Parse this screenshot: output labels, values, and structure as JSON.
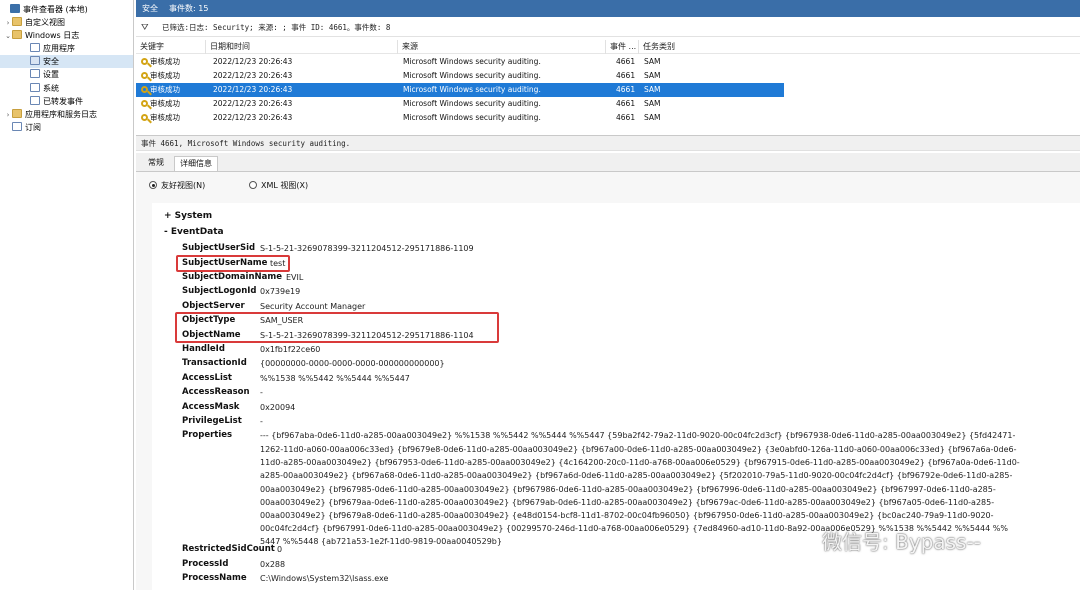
{
  "header": {
    "title": "安全",
    "event_count": "事件数: 15"
  },
  "tree": [
    {
      "label": "事件查看器 (本地)",
      "icon": "viewer-icon",
      "toggle": ""
    },
    {
      "label": "自定义视图",
      "icon": "folder-icon",
      "toggle": ">"
    },
    {
      "label": "Windows 日志",
      "icon": "folder-icon",
      "toggle": "v"
    },
    {
      "label": "应用程序",
      "icon": "log-icon",
      "toggle": ""
    },
    {
      "label": "安全",
      "icon": "log-icon",
      "toggle": "",
      "selected": true
    },
    {
      "label": "设置",
      "icon": "log-icon",
      "toggle": ""
    },
    {
      "label": "系统",
      "icon": "log-icon",
      "toggle": ""
    },
    {
      "label": "已转发事件",
      "icon": "log-icon",
      "toggle": ""
    },
    {
      "label": "应用程序和服务日志",
      "icon": "folder-icon",
      "toggle": ">"
    },
    {
      "label": "订阅",
      "icon": "log-icon",
      "toggle": ""
    }
  ],
  "filter": {
    "text": "已筛选:日志: Security; 来源: ; 事件 ID: 4661。事件数: 8",
    "icon": "filter-icon"
  },
  "columns": {
    "keywords": "关键字",
    "datetime": "日期和时间",
    "source": "来源",
    "event_id": "事件 ...",
    "category": "任务类别"
  },
  "events": [
    {
      "keyword": "审核成功",
      "datetime": "2022/12/23 20:26:43",
      "source": "Microsoft Windows security auditing.",
      "event_id": "4661",
      "category": "SAM"
    },
    {
      "keyword": "审核成功",
      "datetime": "2022/12/23 20:26:43",
      "source": "Microsoft Windows security auditing.",
      "event_id": "4661",
      "category": "SAM"
    },
    {
      "keyword": "审核成功",
      "datetime": "2022/12/23 20:26:43",
      "source": "Microsoft Windows security auditing.",
      "event_id": "4661",
      "category": "SAM",
      "selected": true
    },
    {
      "keyword": "审核成功",
      "datetime": "2022/12/23 20:26:43",
      "source": "Microsoft Windows security auditing.",
      "event_id": "4661",
      "category": "SAM"
    },
    {
      "keyword": "审核成功",
      "datetime": "2022/12/23 20:26:43",
      "source": "Microsoft Windows security auditing.",
      "event_id": "4661",
      "category": "SAM"
    }
  ],
  "detail": {
    "title": "事件 4661, Microsoft Windows security auditing.",
    "tabs": {
      "general": "常规",
      "details": "详细信息"
    },
    "view_friendly": "友好视图(N)",
    "view_xml": "XML 视图(X)",
    "system_label": "+ System",
    "eventdata_label": "- EventData",
    "fields": [
      {
        "key": "SubjectUserSid",
        "value": "S-1-5-21-3269078399-3211204512-295171886-1109"
      },
      {
        "key": "SubjectUserName",
        "value": "test"
      },
      {
        "key": "SubjectDomainName",
        "value": "EVIL"
      },
      {
        "key": "SubjectLogonId",
        "value": "0x739e19"
      },
      {
        "key": "ObjectServer",
        "value": "Security Account Manager"
      },
      {
        "key": "ObjectType",
        "value": "SAM_USER"
      },
      {
        "key": "ObjectName",
        "value": "S-1-5-21-3269078399-3211204512-295171886-1104"
      },
      {
        "key": "HandleId",
        "value": "0x1fb1f22ce60"
      },
      {
        "key": "TransactionId",
        "value": "{00000000-0000-0000-0000-000000000000}"
      },
      {
        "key": "AccessList",
        "value": "%%1538 %%5442 %%5444 %%5447"
      },
      {
        "key": "AccessReason",
        "value": "-"
      },
      {
        "key": "AccessMask",
        "value": "0x20094"
      },
      {
        "key": "PrivilegeList",
        "value": "-"
      },
      {
        "key": "Properties",
        "value": "--- {bf967aba-0de6-11d0-a285-00aa003049e2} %%1538 %%5442 %%5444 %%5447 {59ba2f42-79a2-11d0-9020-00c04fc2d3cf} {bf967938-0de6-11d0-a285-00aa003049e2} {5fd42471-"
      }
    ],
    "properties_lines": [
      "1262-11d0-a060-00aa006c33ed} {bf9679e8-0de6-11d0-a285-00aa003049e2} {bf967a00-0de6-11d0-a285-00aa003049e2} {3e0abfd0-126a-11d0-a060-00aa006c33ed} {bf967a6a-0de6-",
      "11d0-a285-00aa003049e2} {bf967953-0de6-11d0-a285-00aa003049e2} {4c164200-20c0-11d0-a768-00aa006e0529} {bf967915-0de6-11d0-a285-00aa003049e2} {bf967a0a-0de6-11d0-",
      "a285-00aa003049e2} {bf967a68-0de6-11d0-a285-00aa003049e2} {bf967a6d-0de6-11d0-a285-00aa003049e2} {5f202010-79a5-11d0-9020-00c04fc2d4cf} {bf96792e-0de6-11d0-a285-",
      "00aa003049e2} {bf967985-0de6-11d0-a285-00aa003049e2} {bf967986-0de6-11d0-a285-00aa003049e2} {bf967996-0de6-11d0-a285-00aa003049e2} {bf967997-0de6-11d0-a285-",
      "00aa003049e2} {bf9679aa-0de6-11d0-a285-00aa003049e2} {bf9679ab-0de6-11d0-a285-00aa003049e2} {bf9679ac-0de6-11d0-a285-00aa003049e2} {bf967a05-0de6-11d0-a285-",
      "00aa003049e2} {bf9679a8-0de6-11d0-a285-00aa003049e2} {e48d0154-bcf8-11d1-8702-00c04fb96050} {bf967950-0de6-11d0-a285-00aa003049e2} {bc0ac240-79a9-11d0-9020-",
      "00c04fc2d4cf} {bf967991-0de6-11d0-a285-00aa003049e2} {00299570-246d-11d0-a768-00aa006e0529} {7ed84960-ad10-11d0-8a92-00aa006e0529} %%1538 %%5442 %%5444 %%",
      "5447 %%5448 {ab721a53-1e2f-11d0-9819-00aa0040529b}"
    ],
    "tail_fields": [
      {
        "key": "RestrictedSidCount",
        "value": "0"
      },
      {
        "key": "ProcessId",
        "value": "0x288"
      },
      {
        "key": "ProcessName",
        "value": "C:\\Windows\\System32\\lsass.exe"
      }
    ]
  },
  "watermark": {
    "text": "微信号: Bypass--",
    "icon": "wechat-icon"
  },
  "colors": {
    "selection": "#1f7ad6",
    "header": "#3a6ea8",
    "highlight_box": "#d93a3a"
  }
}
